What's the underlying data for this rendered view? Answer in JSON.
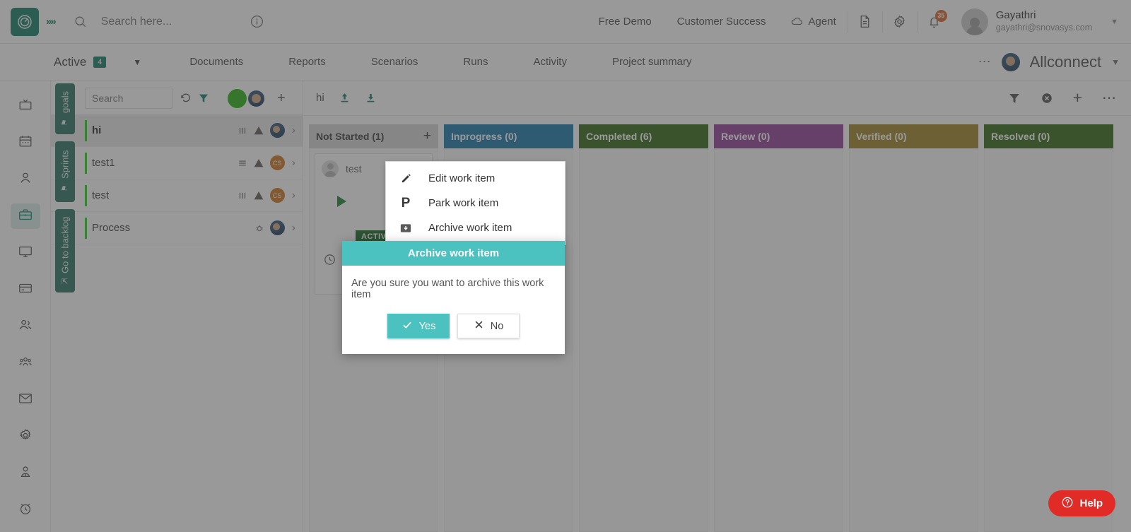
{
  "header": {
    "logo_icon": "clock-logo-icon",
    "expand_icon": "double-chevron-right-icon",
    "search_icon": "search-icon",
    "search_placeholder": "Search here...",
    "info_icon": "info-circle-icon",
    "links": [
      {
        "label": "Free Demo",
        "name": "free-demo-link"
      },
      {
        "label": "Customer Success",
        "name": "customer-success-link"
      }
    ],
    "agent_label": "Agent",
    "agent_icon": "cloud-agent-icon",
    "doc_icon": "document-icon",
    "settings_icon": "gear-icon",
    "notifications_icon": "bell-icon",
    "notification_count": "35",
    "user_name": "Gayathri",
    "user_email": "gayathri@snovasys.com",
    "caret_icon": "chevron-down-icon"
  },
  "nav": {
    "active_label": "Active",
    "active_count": "4",
    "dropdown_icon": "caret-down-icon",
    "items": [
      {
        "label": "Documents",
        "name": "nav-documents"
      },
      {
        "label": "Reports",
        "name": "nav-reports"
      },
      {
        "label": "Scenarios",
        "name": "nav-scenarios"
      },
      {
        "label": "Runs",
        "name": "nav-runs"
      },
      {
        "label": "Activity",
        "name": "nav-activity"
      },
      {
        "label": "Project summary",
        "name": "nav-project-summary"
      }
    ],
    "more_icon": "ellipsis-icon",
    "project_name": "Allconnect",
    "project_caret_icon": "chevron-down-icon"
  },
  "rail": {
    "items": [
      {
        "icon": "target-spiral-icon",
        "selected": false
      },
      {
        "icon": "tv-icon",
        "selected": false
      },
      {
        "icon": "calendar-icon",
        "selected": false
      },
      {
        "icon": "user-icon",
        "selected": false
      },
      {
        "icon": "briefcase-icon",
        "selected": true
      },
      {
        "icon": "monitor-icon",
        "selected": false
      },
      {
        "icon": "credit-card-icon",
        "selected": false
      },
      {
        "icon": "users-icon",
        "selected": false
      },
      {
        "icon": "team-group-icon",
        "selected": false
      },
      {
        "icon": "mail-icon",
        "selected": false
      },
      {
        "icon": "gear-icon",
        "selected": false
      },
      {
        "icon": "person-badge-icon",
        "selected": false
      },
      {
        "icon": "alarm-clock-icon",
        "selected": false
      }
    ]
  },
  "list_panel": {
    "vertical_tabs": [
      {
        "label": "goals",
        "icon": "flag-icon"
      },
      {
        "label": "Sprints",
        "icon": "flag-icon"
      },
      {
        "label": "Go to backlog",
        "icon": "arrow-up-icon"
      }
    ],
    "search_placeholder": "Search",
    "reload_icon": "reload-icon",
    "filter_icon": "filter-icon",
    "status_dot_color": "#22b00e",
    "add_icon": "plus-icon",
    "rows": [
      {
        "title": "hi",
        "active": true,
        "left_icon": "columns-icon",
        "warning_icon": "warning-triangle-icon",
        "avatar": "photo",
        "avatar_text": "",
        "chevron": "chevron-right-icon"
      },
      {
        "title": "test1",
        "active": false,
        "left_icon": "list-icon",
        "warning_icon": "warning-triangle-icon",
        "avatar": "orange",
        "avatar_text": "CS",
        "chevron": "chevron-right-icon"
      },
      {
        "title": "test",
        "active": false,
        "left_icon": "columns-icon",
        "warning_icon": "warning-triangle-icon",
        "avatar": "orange",
        "avatar_text": "CS",
        "chevron": "chevron-right-icon"
      },
      {
        "title": "Process",
        "active": false,
        "left_icon": "bug-icon",
        "warning_icon": "",
        "avatar": "photo",
        "avatar_text": "",
        "chevron": "chevron-right-icon"
      }
    ]
  },
  "board": {
    "title": "hi",
    "upload_icon": "upload-icon",
    "download_icon": "download-icon",
    "toolbar_right": [
      {
        "icon": "filter-icon",
        "name": "board-filter-icon"
      },
      {
        "icon": "clear-filter-icon",
        "name": "board-clear-filter-icon"
      },
      {
        "icon": "plus-icon",
        "name": "board-add-icon"
      },
      {
        "icon": "ellipsis-icon",
        "name": "board-more-icon"
      }
    ],
    "columns": [
      {
        "label": "Not Started (1)",
        "color": "#d5d5d5",
        "has_add": true
      },
      {
        "label": "Inprogress (0)",
        "color": "#1377a8",
        "has_add": false
      },
      {
        "label": "Completed (6)",
        "color": "#2f6410",
        "has_add": false
      },
      {
        "label": "Review (0)",
        "color": "#8e3b94",
        "has_add": false
      },
      {
        "label": "Verified (0)",
        "color": "#9c8121",
        "has_add": false
      },
      {
        "label": "Resolved (0)",
        "color": "#2f6410",
        "has_add": false
      }
    ],
    "card": {
      "title": "test",
      "avatar_icon": "user-avatar-icon",
      "play_icon": "play-icon",
      "badge": "ACTIVITY",
      "clock_icon": "clock-icon"
    }
  },
  "context_menu": {
    "items": [
      {
        "label": "Edit work item",
        "icon": "pencil-icon",
        "name": "menu-edit-work-item"
      },
      {
        "label": "Park work item",
        "icon": "park-p-icon",
        "name": "menu-park-work-item"
      },
      {
        "label": "Archive work item",
        "icon": "archive-box-icon",
        "name": "menu-archive-work-item"
      }
    ]
  },
  "dialog": {
    "title": "Archive work item",
    "message": "Are you sure you want to archive this work item",
    "yes_label": "Yes",
    "yes_icon": "check-icon",
    "no_label": "No",
    "no_icon": "cross-icon"
  },
  "help": {
    "label": "Help",
    "icon": "question-circle-icon"
  }
}
